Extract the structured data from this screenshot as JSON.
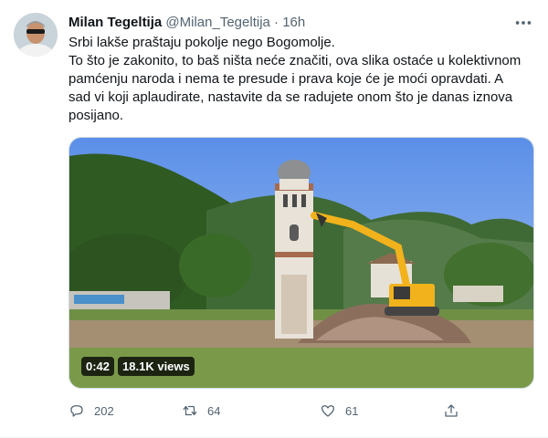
{
  "tweet": {
    "display_name": "Milan Tegeltija",
    "handle": "@Milan_Tegeltija",
    "separator": "·",
    "time": "16h",
    "text": "Srbi lakše praštaju pokolje nego Bogomolje.\nTo što je zakonito, to baš ništa neće značiti, ova slika ostaće u kolektivnom pamćenju naroda i nema te presude i prava koje će je moći opravdati. A sad vi koji aplaudirate, nastavite da se radujete onom što je danas iznova posijano."
  },
  "video": {
    "duration": "0:42",
    "views": "18.1K views"
  },
  "actions": {
    "replies": "202",
    "retweets": "64",
    "likes": "61"
  },
  "icons": [
    "more-icon",
    "reply-icon",
    "retweet-icon",
    "like-icon",
    "share-icon"
  ],
  "colors": {
    "text": "#0f1419",
    "muted": "#536471",
    "border": "#cfd9de"
  }
}
